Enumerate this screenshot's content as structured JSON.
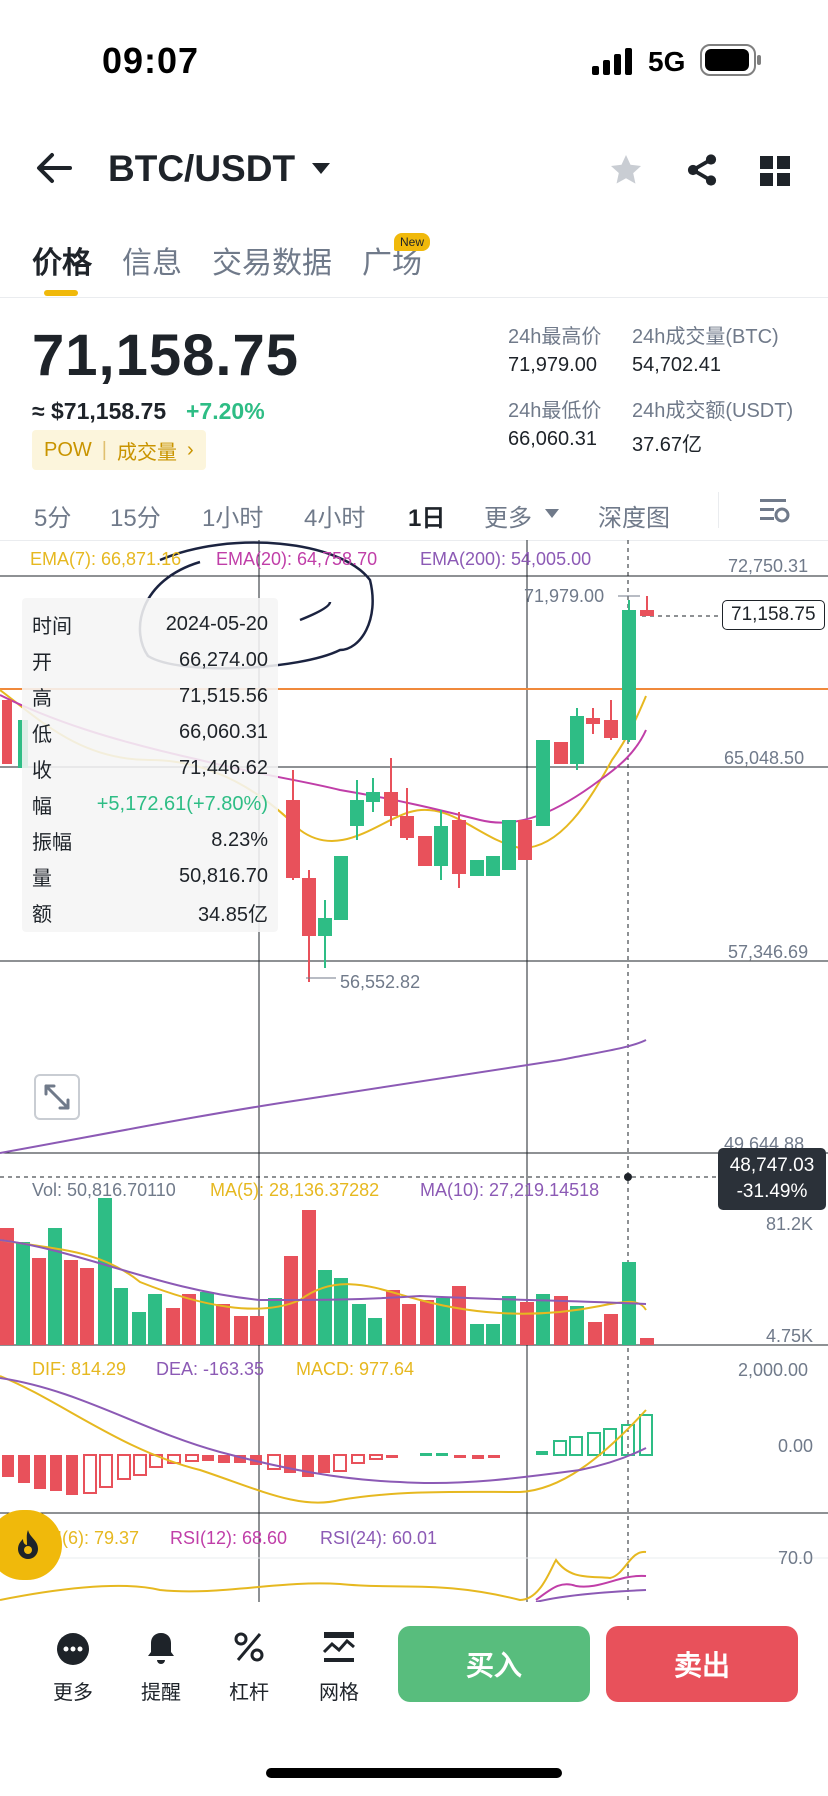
{
  "status_bar": {
    "time": "09:07",
    "network": "5G"
  },
  "header": {
    "pair": "BTC/USDT"
  },
  "tabs": [
    {
      "label": "价格",
      "active": true
    },
    {
      "label": "信息"
    },
    {
      "label": "交易数据"
    },
    {
      "label": "广场",
      "badge": "New"
    }
  ],
  "price": {
    "last": "71,158.75",
    "usd": "≈ $71,158.75",
    "change_pct": "+7.20%",
    "tag_pow": "POW",
    "tag_volume": "成交量",
    "up_color": "#2ebd85",
    "down_color": "#e8515b"
  },
  "stats": {
    "high_label": "24h最高价",
    "high": "71,979.00",
    "vol_btc_label": "24h成交量(BTC)",
    "vol_btc": "54,702.41",
    "low_label": "24h最低价",
    "low": "66,060.31",
    "vol_usdt_label": "24h成交额(USDT)",
    "vol_usdt": "37.67亿"
  },
  "timeframes": [
    {
      "label": "5分"
    },
    {
      "label": "15分"
    },
    {
      "label": "1小时"
    },
    {
      "label": "4小时"
    },
    {
      "label": "1日",
      "active": true
    },
    {
      "label": "更多"
    },
    {
      "label": "深度图"
    }
  ],
  "ema": {
    "ema7": "EMA(7): 66,871.16",
    "ema20": "EMA(20): 64,758.70",
    "ema200": "EMA(200): 54,005.00"
  },
  "axis": {
    "p1": "72,750.31",
    "p2": "65,048.50",
    "p3": "57,346.69",
    "p4": "49,644.88",
    "high_mark": "71,979.00",
    "low_mark": "56,552.82",
    "last_tag": "71,158.75",
    "cross_price": "48,747.03",
    "cross_pct": "-31.49%"
  },
  "tooltip": {
    "rows": [
      {
        "k": "时间",
        "v": "2024-05-20"
      },
      {
        "k": "开",
        "v": "66,274.00"
      },
      {
        "k": "高",
        "v": "71,515.56"
      },
      {
        "k": "低",
        "v": "66,060.31"
      },
      {
        "k": "收",
        "v": "71,446.62"
      },
      {
        "k": "幅",
        "v": "+5,172.61(+7.80%)"
      },
      {
        "k": "振幅",
        "v": "8.23%"
      },
      {
        "k": "量",
        "v": "50,816.70"
      },
      {
        "k": "额",
        "v": "34.85亿"
      }
    ]
  },
  "volume": {
    "vol": "Vol: 50,816.70110",
    "ma5": "MA(5): 28,136.37282",
    "ma10": "MA(10): 27,219.14518",
    "max": "81.2K",
    "min": "4.75K"
  },
  "macd": {
    "dif": "DIF: 814.29",
    "dea": "DEA: -163.35",
    "macd": "MACD: 977.64",
    "top": "2,000.00",
    "zero": "0.00"
  },
  "rsi": {
    "rsi6": "RSI(6): 79.37",
    "rsi12": "RSI(12): 68.60",
    "rsi24": "RSI(24): 60.01",
    "level": "70.0"
  },
  "bottom_nav": [
    {
      "label": "更多",
      "icon": "more-dots-icon"
    },
    {
      "label": "提醒",
      "icon": "bell-icon"
    },
    {
      "label": "杠杆",
      "icon": "percent-icon"
    },
    {
      "label": "网格",
      "icon": "grid-chart-icon"
    }
  ],
  "actions": {
    "buy": "买入",
    "sell": "卖出"
  }
}
